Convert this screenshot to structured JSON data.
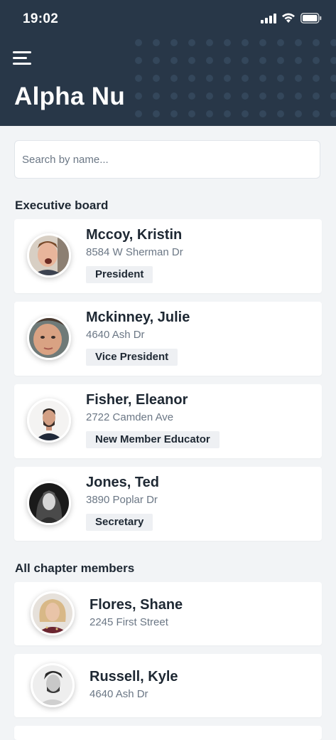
{
  "status_bar": {
    "time": "19:02"
  },
  "header": {
    "title": "Alpha Nu"
  },
  "search": {
    "placeholder": "Search by name..."
  },
  "executive_board": {
    "title": "Executive board",
    "members": [
      {
        "name": "Mccoy, Kristin",
        "address": "8584 W Sherman Dr",
        "role": "President"
      },
      {
        "name": "Mckinney, Julie",
        "address": "4640 Ash Dr",
        "role": "Vice President"
      },
      {
        "name": "Fisher, Eleanor",
        "address": "2722 Camden Ave",
        "role": "New Member Educator"
      },
      {
        "name": "Jones, Ted",
        "address": "3890 Poplar Dr",
        "role": "Secretary"
      }
    ]
  },
  "all_members": {
    "title": "All chapter members",
    "members": [
      {
        "name": "Flores, Shane",
        "address": "2245 First Street"
      },
      {
        "name": "Russell, Kyle",
        "address": "4640 Ash Dr"
      }
    ]
  },
  "colors": {
    "header_bg": "#283748",
    "page_bg": "#f2f4f6",
    "badge_bg": "#eef0f3",
    "muted_text": "#6b7785"
  }
}
